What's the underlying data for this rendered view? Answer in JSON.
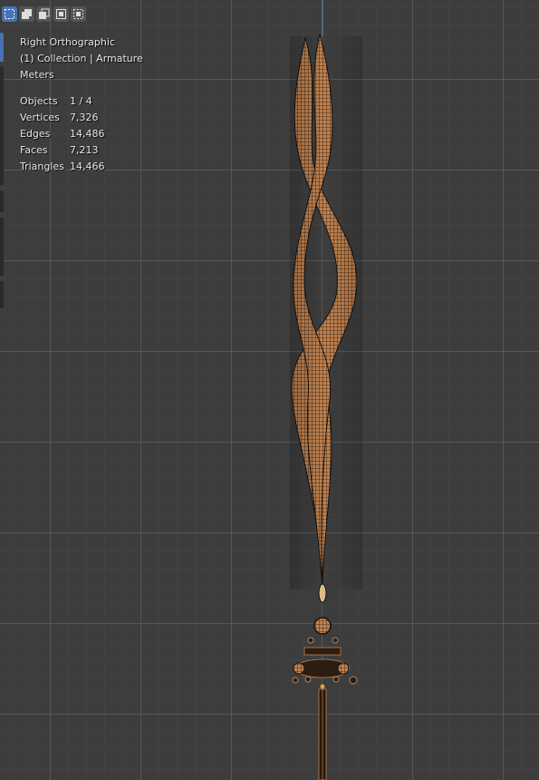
{
  "viewport": {
    "view_name": "Right Orthographic",
    "collection_info": "(1) Collection | Armature",
    "units": "Meters",
    "stats": [
      {
        "label": "Objects",
        "value": "1 / 4"
      },
      {
        "label": "Vertices",
        "value": "7,326"
      },
      {
        "label": "Edges",
        "value": "14,486"
      },
      {
        "label": "Faces",
        "value": "7,213"
      },
      {
        "label": "Triangles",
        "value": "14,466"
      }
    ]
  },
  "toolbar": {
    "modes": [
      {
        "name": "select-box-icon",
        "active": true
      },
      {
        "name": "select-extend-icon",
        "active": false
      },
      {
        "name": "select-subtract-icon",
        "active": false
      },
      {
        "name": "select-intersect-icon",
        "active": false
      },
      {
        "name": "select-invert-icon",
        "active": false
      }
    ]
  },
  "colors": {
    "grid_background": "#3d3d3d",
    "accent": "#4772b3",
    "mesh": "#c8864f",
    "wire": "#1a1a1a"
  }
}
